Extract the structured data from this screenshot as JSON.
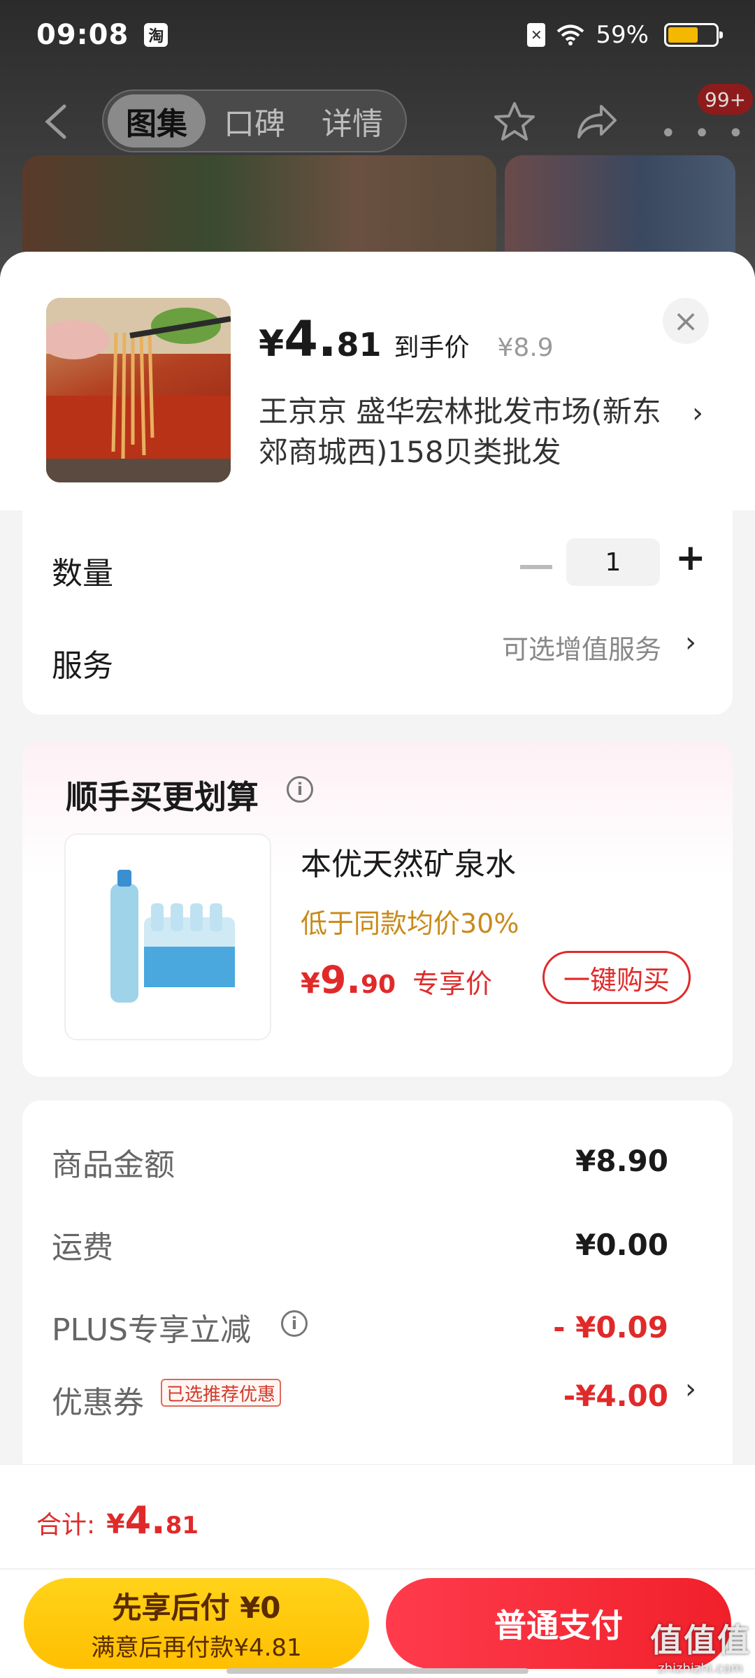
{
  "status_bar": {
    "time": "09:08",
    "app_badge": "淘",
    "sim_glyph": "✕",
    "battery_percent": "59%",
    "battery_level": 0.59
  },
  "nav": {
    "tabs": [
      {
        "label": "图集",
        "active": true
      },
      {
        "label": "口碑",
        "active": false
      },
      {
        "label": "详情",
        "active": false
      }
    ],
    "more_glyph": "• • •",
    "badge": "99+"
  },
  "product": {
    "price_yen": "¥",
    "price_int": "4.",
    "price_dec": "81",
    "price_tag": "到手价",
    "original_price": "¥8.9",
    "shop_name": "王京京  盛华宏林批发市场(新东郊商城西)158贝类批发",
    "shop_arrow": "›",
    "close_glyph": "×"
  },
  "quantity": {
    "label": "数量",
    "value": "1",
    "minus_glyph": "",
    "plus_glyph": "+"
  },
  "service": {
    "label": "服务",
    "value": "可选增值服务",
    "arrow": "›"
  },
  "upsell": {
    "title": "顺手买更划算",
    "info_glyph": "i",
    "item_name": "本优天然矿泉水",
    "tip": "低于同款均价30%",
    "price_yen": "¥",
    "price_int": "9.",
    "price_dec": "90",
    "price_tag": "专享价",
    "buy_label": "一键购买"
  },
  "amounts": {
    "goods_label": "商品金额",
    "goods_value": "¥8.90",
    "shipping_label": "运费",
    "shipping_value": "¥0.00",
    "plus_label": "PLUS专享立减",
    "plus_value": "- ¥0.09",
    "coupon_label": "优惠券",
    "coupon_tag": "已选推荐优惠",
    "coupon_value": "-¥4.00",
    "coupon_arrow": "›"
  },
  "footer": {
    "total_label": "合计:",
    "total_yen": "¥",
    "total_int": "4.",
    "total_dec": "81",
    "pay_later_main": "先享后付 ¥0",
    "pay_later_sub": "满意后再付款¥4.81",
    "pay_label": "普通支付"
  },
  "watermark": {
    "big": "值值值",
    "small": "zhizhizhi.com"
  },
  "colors": {
    "accent_red": "#e02a2a",
    "pay_later_yellow": "#ffc400",
    "tip_gold": "#c98a1a"
  }
}
